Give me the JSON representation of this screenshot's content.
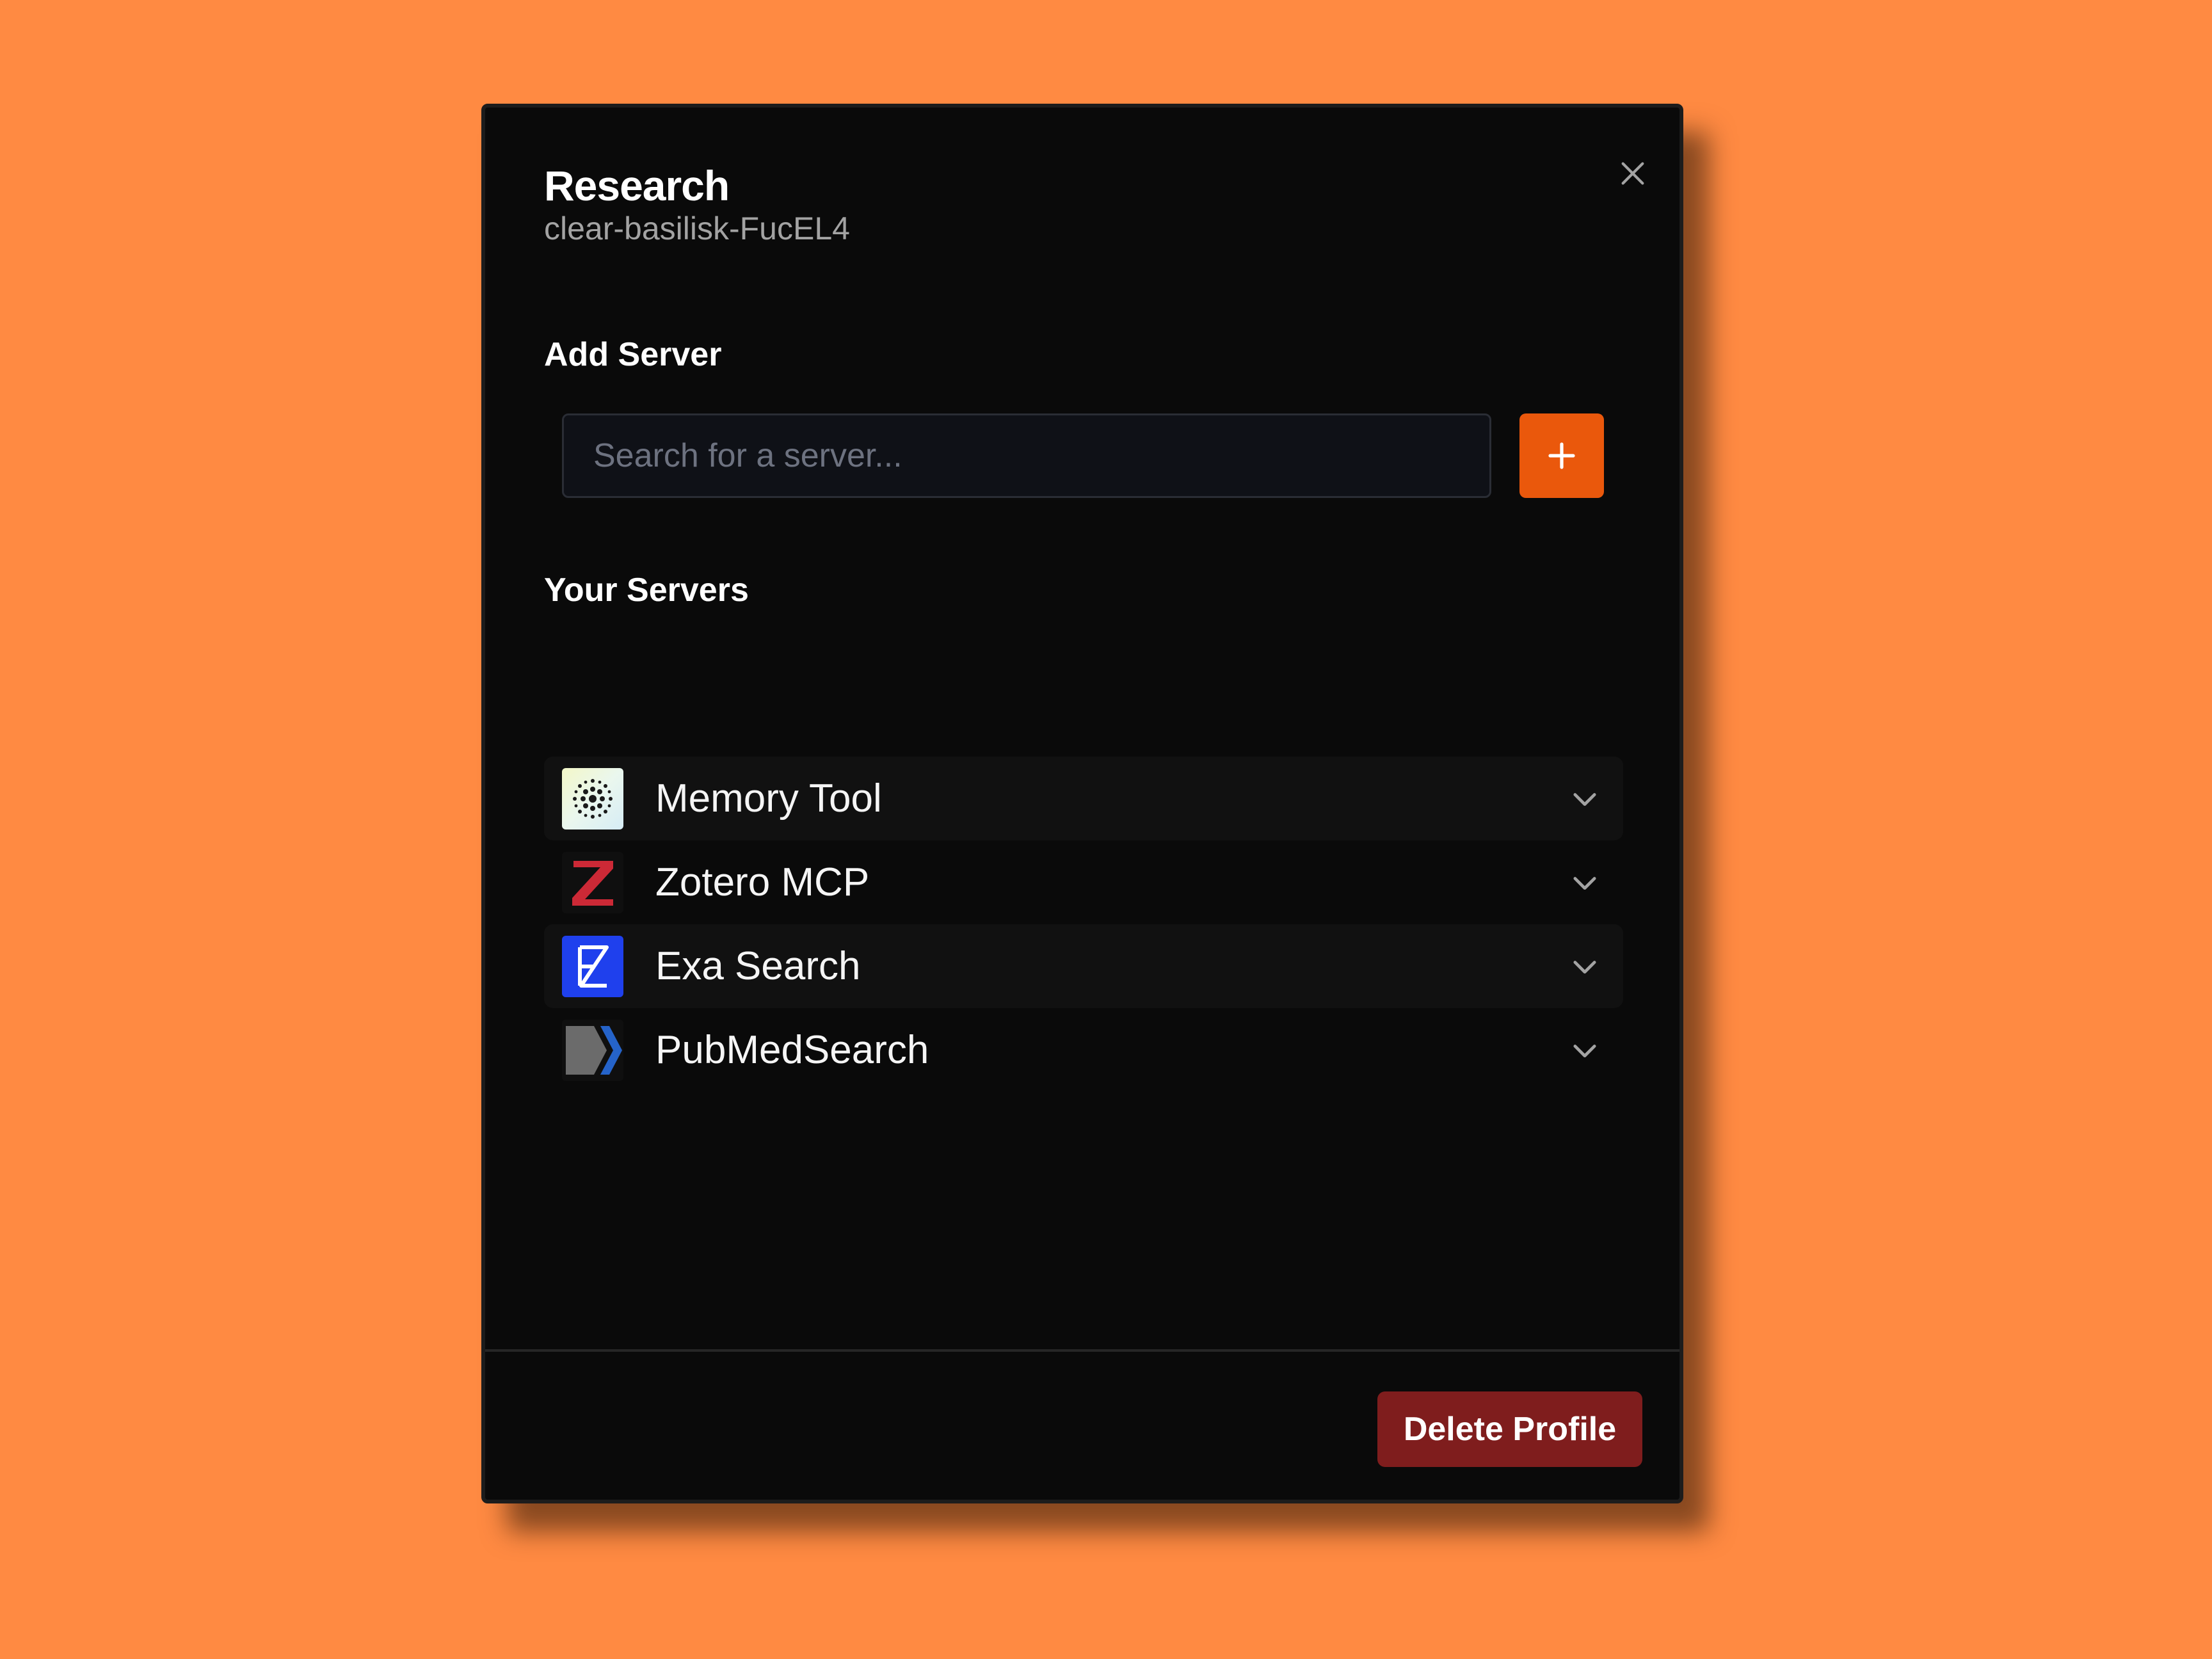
{
  "profile": {
    "title": "Research",
    "subtitle": "clear-basilisk-FucEL4"
  },
  "add_server": {
    "label": "Add Server",
    "search_placeholder": "Search for a server...",
    "add_button_icon": "plus-icon"
  },
  "your_servers": {
    "label": "Your Servers",
    "items": [
      {
        "name": "Memory Tool",
        "icon": "memory-tool-logo-icon"
      },
      {
        "name": "Zotero MCP",
        "icon": "zotero-logo-icon"
      },
      {
        "name": "Exa Search",
        "icon": "exa-logo-icon"
      },
      {
        "name": "PubMedSearch",
        "icon": "pubmed-logo-icon"
      }
    ]
  },
  "footer": {
    "delete_label": "Delete Profile"
  },
  "colors": {
    "background": "#FF8A42",
    "modal": "#0A0A0A",
    "accent": "#EA580C",
    "danger": "#7F1D1D"
  }
}
